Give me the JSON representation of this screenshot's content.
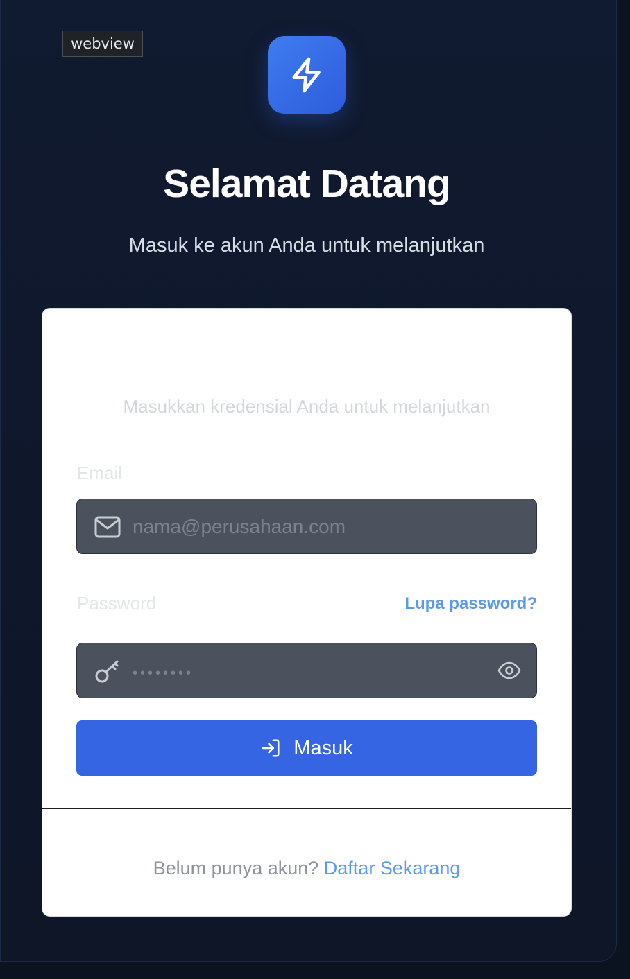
{
  "webview_tag": "webview",
  "header": {
    "title": "Selamat Datang",
    "subtitle": "Masuk ke akun Anda untuk melanjutkan"
  },
  "card": {
    "description": "Masukkan kredensial Anda untuk melanjutkan",
    "email": {
      "label": "Email",
      "placeholder": "nama@perusahaan.com",
      "value": ""
    },
    "password": {
      "label": "Password",
      "placeholder": "••••••••",
      "value": "",
      "forgot_label": "Lupa password?"
    },
    "submit_label": "Masuk",
    "footer": {
      "prompt": "Belum punya akun? ",
      "link": "Daftar Sekarang"
    }
  },
  "icons": {
    "logo": "lightning-bolt-icon",
    "email": "mail-icon",
    "password": "key-icon",
    "toggle": "eye-icon",
    "submit": "log-in-icon"
  },
  "colors": {
    "accent": "#3565e3",
    "link": "#5b9aea",
    "background": "#0f182b"
  }
}
